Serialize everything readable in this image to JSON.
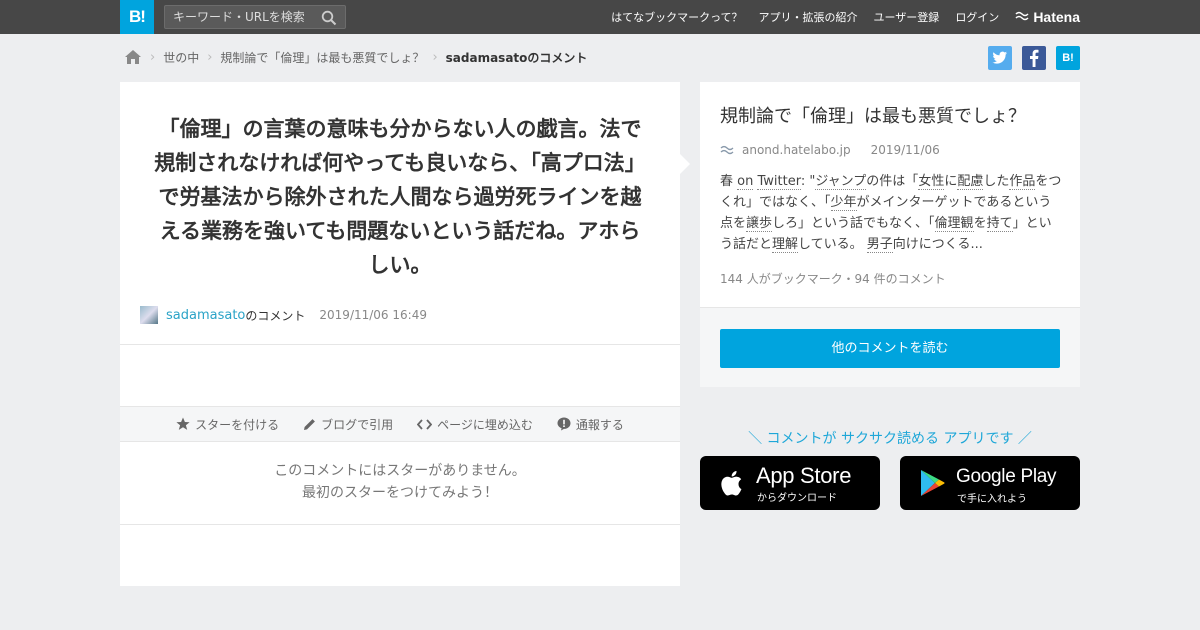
{
  "header": {
    "logo": "B!",
    "search_placeholder": "キーワード・URLを検索",
    "nav": [
      "はてなブックマークって？",
      "アプリ・拡張の紹介",
      "ユーザー登録",
      "ログイン"
    ],
    "brand": "Hatena"
  },
  "breadcrumb": {
    "items": [
      "世の中",
      "規制論で「倫理」は最も悪質でしょ？"
    ],
    "current": "sadamasatoのコメント"
  },
  "share": {
    "twitter": "t",
    "facebook": "f",
    "hatena": "B!"
  },
  "comment": {
    "text": "「倫理」の言葉の意味も分からない人の戯言。法で規制されなければ何やっても良いなら、「高プロ法」で労基法から除外された人間なら過労死ラインを越える業務を強いても問題ないという話だね。アホらしい。",
    "user": "sadamasato",
    "suffix": "のコメント",
    "date": "2019/11/06 16:49"
  },
  "actions": {
    "star": "スターを付ける",
    "blog": "ブログで引用",
    "embed": "ページに埋め込む",
    "report": "通報する"
  },
  "nostar": {
    "line1": "このコメントにはスターがありません。",
    "line2": "最初のスターをつけてみよう！"
  },
  "entry": {
    "title": "規制論で「倫理」は最も悪質でしょ？",
    "source": "anond.hatelabo.jp",
    "date": "2019/11/06",
    "body_parts": [
      "春 ",
      "on",
      " ",
      "Twitter",
      ": \"",
      "ジャンプ",
      "の件は「",
      "女性",
      "に",
      "配慮",
      "した",
      "作品",
      "をつくれ」ではなく、「",
      "少年",
      "がメインターゲットであるという点を",
      "譲歩",
      "しろ」という話でもなく、「",
      "倫理観",
      "を",
      "持て",
      "」という話だと",
      "理解",
      "している。 ",
      "男子",
      "向けにつくる..."
    ],
    "count": "144 人がブックマーク・94 件のコメント",
    "more_button": "他のコメントを読む"
  },
  "promo": {
    "text": "＼ コメントが サクサク読める アプリです ／",
    "appstore_big": "App Store",
    "appstore_small": "からダウンロード",
    "googleplay_big": "Google Play",
    "googleplay_small": "で手に入れよう"
  },
  "colors": {
    "brand_blue": "#00a4de",
    "topbar": "#474747",
    "background": "#edeef0"
  }
}
